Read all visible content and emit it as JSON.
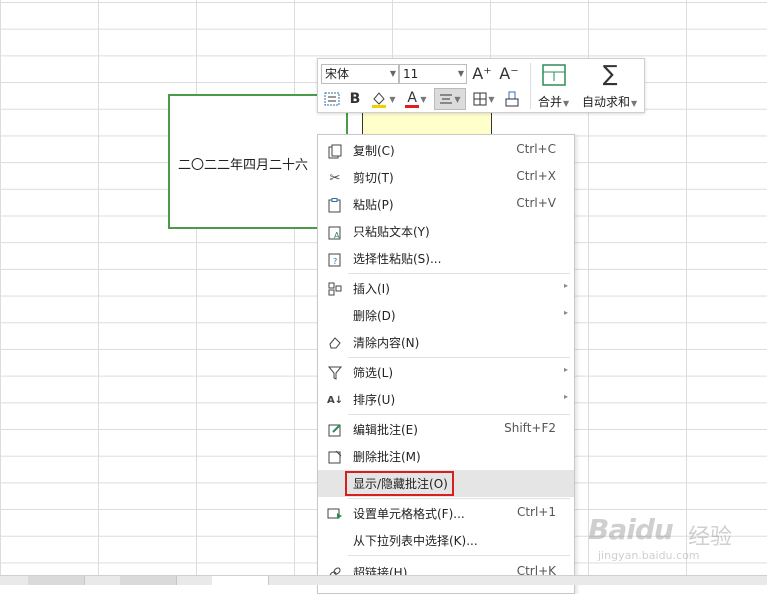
{
  "cell": {
    "text": "二〇二二年四月二十六"
  },
  "toolbar": {
    "font_name": "宋体",
    "font_size": "11",
    "grow_font": "A⁺",
    "shrink_font": "A⁻",
    "bold": "B",
    "font_color_letter": "A",
    "merge_label": "合并",
    "autosum_label": "自动求和"
  },
  "menu": {
    "items": [
      {
        "icon": "copy-icon",
        "label": "复制(C)",
        "shortcut": "Ctrl+C",
        "submenu": false
      },
      {
        "icon": "scissors-icon",
        "label": "剪切(T)",
        "shortcut": "Ctrl+X",
        "submenu": false
      },
      {
        "icon": "paste-icon",
        "label": "粘贴(P)",
        "shortcut": "Ctrl+V",
        "submenu": false
      },
      {
        "icon": "paste-text-icon",
        "label": "只粘贴文本(Y)",
        "shortcut": "",
        "submenu": false
      },
      {
        "icon": "paste-special-icon",
        "label": "选择性粘贴(S)...",
        "shortcut": "",
        "submenu": false
      },
      {
        "icon": "insert-icon",
        "label": "插入(I)",
        "shortcut": "",
        "submenu": true
      },
      {
        "icon": "",
        "label": "删除(D)",
        "shortcut": "",
        "submenu": true
      },
      {
        "icon": "eraser-icon",
        "label": "清除内容(N)",
        "shortcut": "",
        "submenu": false
      },
      {
        "icon": "filter-icon",
        "label": "筛选(L)",
        "shortcut": "",
        "submenu": true
      },
      {
        "icon": "sort-icon",
        "label": "排序(U)",
        "shortcut": "",
        "submenu": true
      },
      {
        "icon": "edit-comment-icon",
        "label": "编辑批注(E)",
        "shortcut": "Shift+F2",
        "submenu": false
      },
      {
        "icon": "delete-comment-icon",
        "label": "删除批注(M)",
        "shortcut": "",
        "submenu": false
      },
      {
        "icon": "",
        "label": "显示/隐藏批注(O)",
        "shortcut": "",
        "submenu": false
      },
      {
        "icon": "format-cells-icon",
        "label": "设置单元格格式(F)...",
        "shortcut": "Ctrl+1",
        "submenu": false
      },
      {
        "icon": "",
        "label": "从下拉列表中选择(K)...",
        "shortcut": "",
        "submenu": false
      },
      {
        "icon": "link-icon",
        "label": "超链接(H)...",
        "shortcut": "Ctrl+K",
        "submenu": false
      }
    ]
  },
  "watermark": {
    "logo": "Baidu",
    "jingyan": "经验",
    "url": "jingyan.baidu.com"
  },
  "colors": {
    "accent_green": "#4a9a4a",
    "highlight_red": "#d62020",
    "comment_yellow": "#ffffcc",
    "font_color_red": "#e02020"
  }
}
